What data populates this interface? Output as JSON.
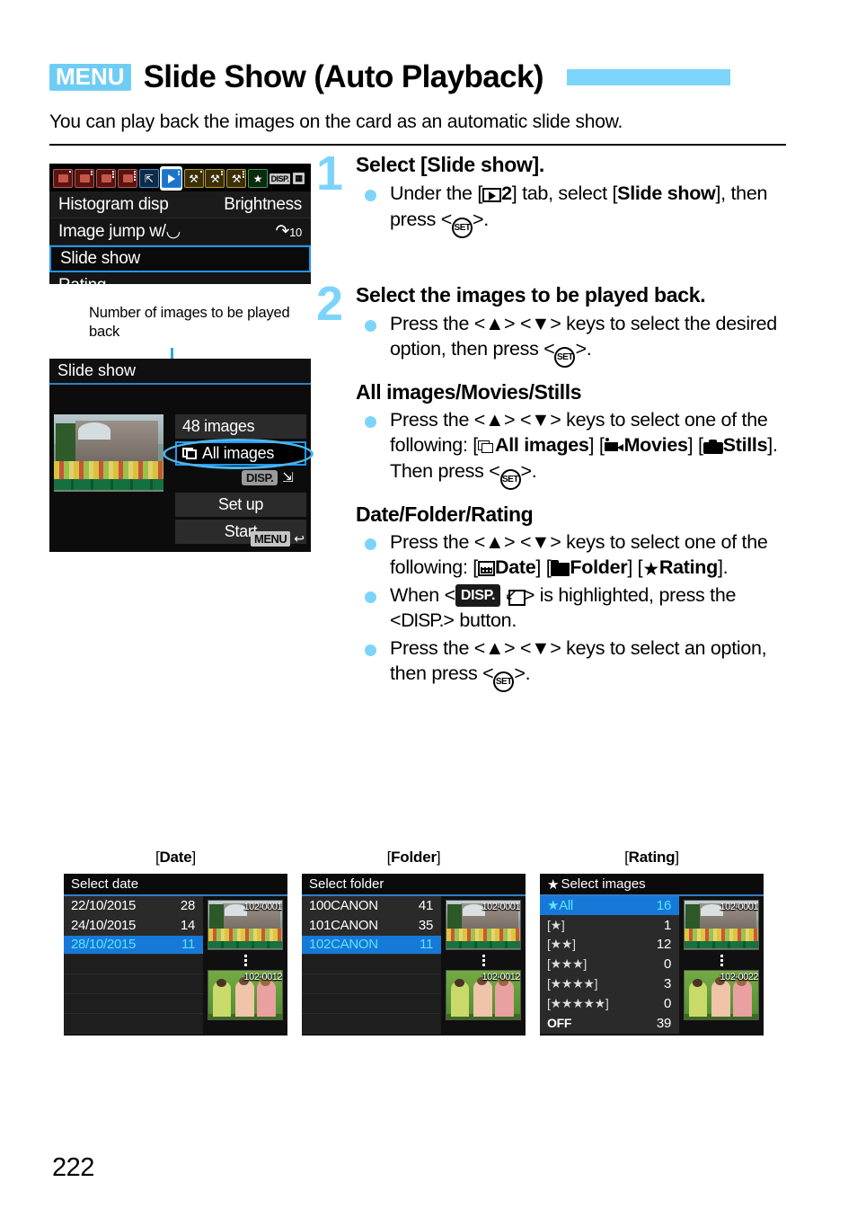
{
  "header": {
    "menu_badge": "MENU",
    "title": "Slide Show (Auto Playback)",
    "intro": "You can play back the images on the card as an automatic slide show."
  },
  "menu_screen": {
    "tabs": [
      {
        "name": "shoot-1",
        "color": "red"
      },
      {
        "name": "shoot-2",
        "color": "red"
      },
      {
        "name": "shoot-3",
        "color": "red"
      },
      {
        "name": "shoot-4",
        "color": "red"
      },
      {
        "name": "autofocus",
        "color": "blue"
      },
      {
        "name": "playback-2",
        "color": "blue",
        "selected": true
      },
      {
        "name": "setup-1",
        "color": "yellow"
      },
      {
        "name": "setup-2",
        "color": "yellow"
      },
      {
        "name": "setup-3",
        "color": "yellow"
      },
      {
        "name": "my-menu",
        "color": "green"
      }
    ],
    "disp_label": "DISP.",
    "rows": [
      {
        "label": "Histogram disp",
        "value": "Brightness",
        "selected": false
      },
      {
        "label": "Image jump w/",
        "value": "10",
        "selected": false
      },
      {
        "label": "Slide show",
        "value": "",
        "selected": true
      },
      {
        "label": "Rating",
        "value": "",
        "selected": false
      }
    ]
  },
  "caption": {
    "text": "Number of images to be played back"
  },
  "slide_screen": {
    "title": "Slide show",
    "count": "48 images",
    "selection": "All images",
    "disp_chip": "DISP.",
    "set_up": "Set up",
    "start": "Start",
    "menu_back": "MENU"
  },
  "steps": [
    {
      "number": "1",
      "head": "Select [Slide show].",
      "bullets": [
        "Under the [▶2] tab, select [Slide show], then press <SET>."
      ]
    },
    {
      "number": "2",
      "head": "Select the images to be played back.",
      "bullets": [
        "Press the <▲> <▼> keys to select the desired option, then press <SET>."
      ]
    }
  ],
  "sections": [
    {
      "head": "All images/Movies/Stills",
      "bullets": [
        "Press the <▲> <▼> keys to select one of the following: [All images] [Movies] [Stills]. Then press <SET>."
      ]
    },
    {
      "head": "Date/Folder/Rating",
      "bullets": [
        "Press the <▲> <▼> keys to select one of the following: [Date] [Folder] [Rating].",
        "When <DISP.> is highlighted, press the <DISP.> button.",
        "Press the <▲> <▼> keys to select an option, then press <SET>."
      ]
    }
  ],
  "inline_labels": {
    "under_the": "Under the [",
    "tab_num": "2",
    "tab_select": "] tab, select [",
    "slide_show_b": "Slide show",
    "then_press": "], then press <",
    "set": "SET",
    "close": ">.",
    "press_the": "Press the <",
    "up": "▲",
    "gt_lt": "> <",
    "down": "▼",
    "keys_select": "> keys to select",
    "desired_option": "the desired option, then press <",
    "one_following": "one of the following: [",
    "all_images_b": "All images",
    "movies_b": "Movies",
    "stills_b": "Stills",
    "then_press2": "]. Then press",
    "date_b": "Date",
    "folder_b": "Folder",
    "rating_b": "Rating",
    "when": "When <",
    "is_highlighted": "> is highlighted,",
    "press_disp": "press the <",
    "disp_btn": "DISP.",
    "button": "> button.",
    "keys_select_an": "> keys to select an",
    "option_then": "option, then press <"
  },
  "shots": [
    {
      "caption_pre": "[",
      "caption_b": "Date",
      "caption_post": "]",
      "title": "Select date",
      "title_star": false,
      "rows": [
        {
          "name": "22/10/2015",
          "count": "28",
          "selected": false
        },
        {
          "name": "24/10/2015",
          "count": "14",
          "selected": false
        },
        {
          "name": "28/10/2015",
          "count": "11",
          "selected": true
        },
        {
          "name": "",
          "count": "",
          "selected": false
        },
        {
          "name": "",
          "count": "",
          "selected": false
        },
        {
          "name": "",
          "count": "",
          "selected": false
        },
        {
          "name": "",
          "count": "",
          "selected": false
        }
      ],
      "thumb_top_tag": "102-0001",
      "thumb_bottom_tag": "102-0012"
    },
    {
      "caption_pre": "[",
      "caption_b": "Folder",
      "caption_post": "]",
      "title": "Select folder",
      "title_star": false,
      "rows": [
        {
          "name": "100CANON",
          "count": "41",
          "selected": false
        },
        {
          "name": "101CANON",
          "count": "35",
          "selected": false
        },
        {
          "name": "102CANON",
          "count": "11",
          "selected": true
        },
        {
          "name": "",
          "count": "",
          "selected": false
        },
        {
          "name": "",
          "count": "",
          "selected": false
        },
        {
          "name": "",
          "count": "",
          "selected": false
        },
        {
          "name": "",
          "count": "",
          "selected": false
        }
      ],
      "thumb_top_tag": "102-0001",
      "thumb_bottom_tag": "102-0012"
    },
    {
      "caption_pre": "[",
      "caption_b": "Rating",
      "caption_post": "]",
      "title": "Select images",
      "title_star": true,
      "rows": [
        {
          "name": "All",
          "count": "16",
          "selected": true,
          "icon": "star"
        },
        {
          "name": "",
          "count": "1",
          "selected": false,
          "icon": "rate1"
        },
        {
          "name": "",
          "count": "12",
          "selected": false,
          "icon": "rate2"
        },
        {
          "name": "",
          "count": "0",
          "selected": false,
          "icon": "rate3"
        },
        {
          "name": "",
          "count": "3",
          "selected": false,
          "icon": "rate4"
        },
        {
          "name": "",
          "count": "0",
          "selected": false,
          "icon": "rate5"
        },
        {
          "name": "OFF",
          "count": "39",
          "selected": false,
          "icon": "off"
        }
      ],
      "thumb_top_tag": "102-0001",
      "thumb_bottom_tag": "102-0022"
    }
  ],
  "footer": {
    "page_number": "222"
  },
  "colors": {
    "accent_blue": "#7dd4fa",
    "menu_badge_blue": "#6fcdf5",
    "selection_blue": "#1679d8",
    "screen_black": "#101010"
  }
}
